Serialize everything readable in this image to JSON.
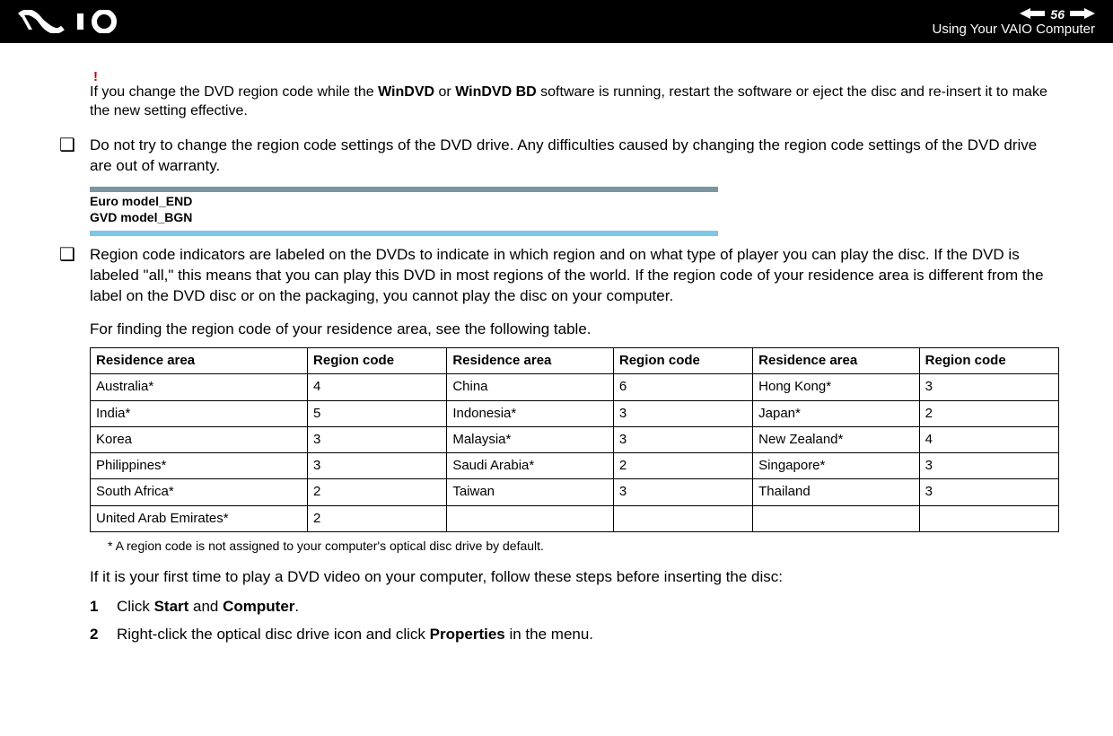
{
  "header": {
    "page_number": "56",
    "title": "Using Your VAIO Computer",
    "nav_label": "n N"
  },
  "warning": {
    "mark": "!",
    "text_prefix": "If you change the DVD region code while the ",
    "win1": "WinDVD",
    "text_mid": " or ",
    "win2": "WinDVD BD",
    "text_suffix": " software is running, restart the software or eject the disc and re-insert it to make the new setting effective."
  },
  "bullet1": "Do not try to change the region code settings of the DVD drive. Any difficulties caused by changing the region code settings of the DVD drive are out of warranty.",
  "marker1": "Euro model_END",
  "marker2": "GVD model_BGN",
  "bullet2_p1": "Region code indicators are labeled on the DVDs to indicate in which region and on what type of player you can play the disc. If the DVD is labeled \"all,\" this means that you can play this DVD in most regions of the world. If the region code of your residence area is different from the label on the DVD disc or on the packaging, you cannot play the disc on your computer.",
  "bullet2_p2": "For finding the region code of your residence area, see the following table.",
  "table": {
    "headers": [
      "Residence area",
      "Region code",
      "Residence area",
      "Region code",
      "Residence area",
      "Region code"
    ],
    "rows": [
      [
        "Australia*",
        "4",
        "China",
        "6",
        "Hong Kong*",
        "3"
      ],
      [
        "India*",
        "5",
        "Indonesia*",
        "3",
        "Japan*",
        "2"
      ],
      [
        "Korea",
        "3",
        "Malaysia*",
        "3",
        "New Zealand*",
        "4"
      ],
      [
        "Philippines*",
        "3",
        "Saudi Arabia*",
        "2",
        "Singapore*",
        "3"
      ],
      [
        "South Africa*",
        "2",
        "Taiwan",
        "3",
        "Thailand",
        "3"
      ],
      [
        "United Arab Emirates*",
        "2",
        "",
        "",
        "",
        ""
      ]
    ]
  },
  "footnote": "*    A region code is not assigned to your computer's optical disc drive by default.",
  "steps_intro": "If it is your first time to play a DVD video on your computer, follow these steps before inserting the disc:",
  "step1": {
    "num": "1",
    "prefix": "Click ",
    "b1": "Start",
    "mid": " and ",
    "b2": "Computer",
    "suffix": "."
  },
  "step2": {
    "num": "2",
    "prefix": "Right-click the optical disc drive icon and click ",
    "b1": "Properties",
    "suffix": " in the menu."
  }
}
